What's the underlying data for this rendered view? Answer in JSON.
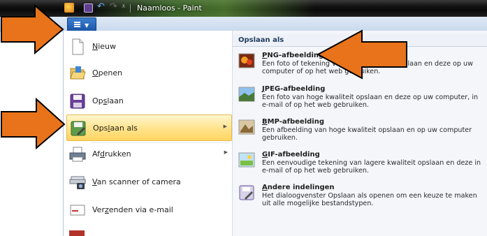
{
  "window": {
    "title": "Naamloos - Paint"
  },
  "app_button": {
    "icon": "app-menu-icon"
  },
  "menu": {
    "items": [
      {
        "label_pre": "",
        "label_key": "N",
        "label_post": "ieuw",
        "icon": "new-file-icon",
        "has_submenu": false
      },
      {
        "label_pre": "",
        "label_key": "O",
        "label_post": "penen",
        "icon": "open-folder-icon",
        "has_submenu": false
      },
      {
        "label_pre": "Op",
        "label_key": "s",
        "label_post": "laan",
        "icon": "save-icon",
        "has_submenu": false
      },
      {
        "label_pre": "Ops",
        "label_key": "l",
        "label_post": "aan als",
        "icon": "save-as-icon",
        "has_submenu": true,
        "selected": true
      },
      {
        "label_pre": "Af",
        "label_key": "d",
        "label_post": "rukken",
        "icon": "printer-icon",
        "has_submenu": true
      },
      {
        "label_pre": "",
        "label_key": "V",
        "label_post": "an scanner of camera",
        "icon": "scanner-camera-icon",
        "has_submenu": false
      },
      {
        "label_pre": "Ver",
        "label_key": "z",
        "label_post": "enden via e-mail",
        "icon": "email-icon",
        "has_submenu": false
      }
    ]
  },
  "submenu": {
    "header": "Opslaan als",
    "items": [
      {
        "title_key": "P",
        "title_rest": "NG-afbeelding",
        "desc": "Een foto of tekening van hoge kwaliteit opslaan en deze op uw computer of op het web gebruiken.",
        "icon": "png-image-icon"
      },
      {
        "title_key": "J",
        "title_rest": "PEG-afbeelding",
        "desc": "Een foto van hoge kwaliteit opslaan en deze op uw computer, in e-mail of op het web gebruiken.",
        "icon": "jpeg-image-icon"
      },
      {
        "title_key": "B",
        "title_rest": "MP-afbeelding",
        "desc": "Een afbeelding van hoge kwaliteit opslaan en op uw computer gebruiken.",
        "icon": "bmp-image-icon"
      },
      {
        "title_key": "G",
        "title_rest": "IF-afbeelding",
        "desc": "Een eenvoudige tekening van lagere kwaliteit opslaan en deze in e-mail of op het web gebruiken.",
        "icon": "gif-image-icon"
      },
      {
        "title_key": "A",
        "title_rest": "ndere indelingen",
        "desc": "Het dialoogvenster Opslaan als openen om een keuze te maken uit alle mogelijke bestandstypen.",
        "icon": "other-formats-icon"
      }
    ]
  },
  "colors": {
    "accent_arrow": "#e8731a",
    "highlight": "#ffe38a"
  }
}
